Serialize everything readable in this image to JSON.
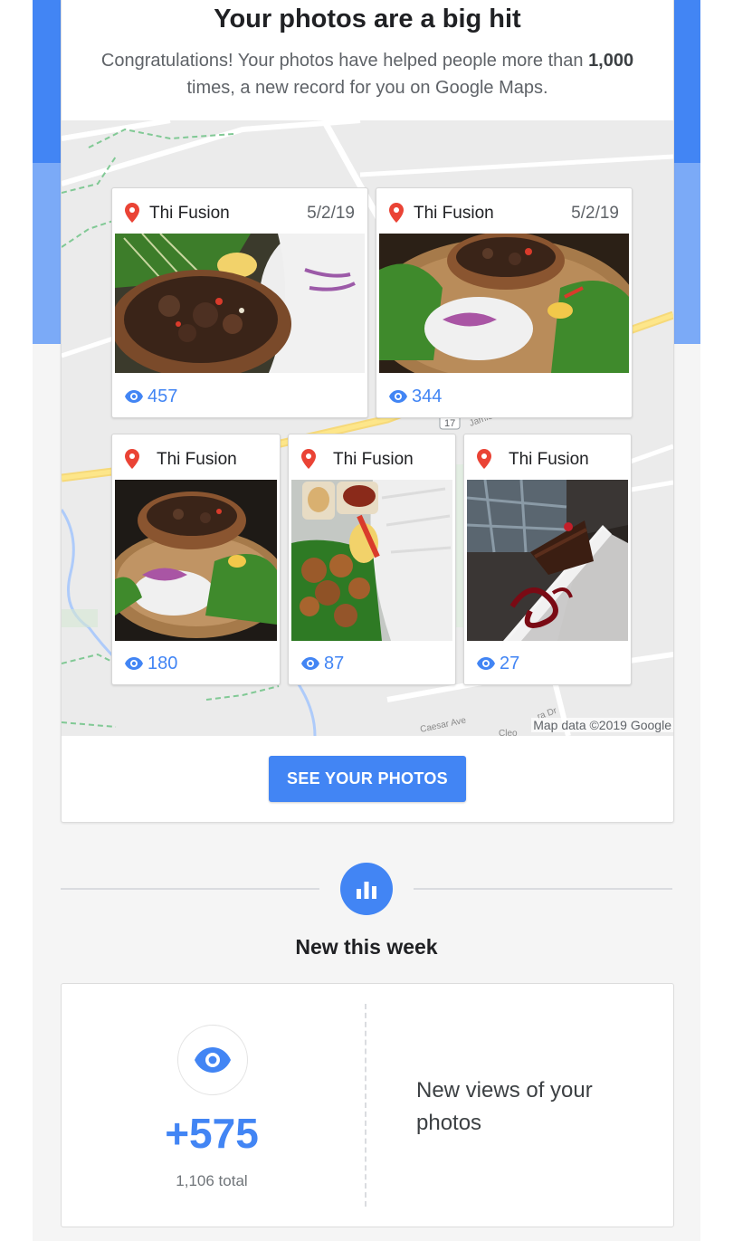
{
  "header": {
    "title": "Your photos are a big hit",
    "subtitle_before": "Congratulations! Your photos have helped people more than ",
    "subtitle_bold": "1,000",
    "subtitle_after": " times, a new record for you on Google Maps."
  },
  "map": {
    "credit": "Map data ©2019 Google",
    "street_labels": [
      "Caesar Ave",
      "Jamie",
      "Cleo",
      "ra Dr",
      "17"
    ]
  },
  "photos": [
    {
      "place": "Thi Fusion",
      "date": "5/2/19",
      "views": "457",
      "subject": "pork bowl with vermicelli"
    },
    {
      "place": "Thi Fusion",
      "date": "5/2/19",
      "views": "344",
      "subject": "bowl on basket"
    },
    {
      "place": "Thi Fusion",
      "views": "180",
      "subject": "bowl on basket"
    },
    {
      "place": "Thi Fusion",
      "views": "87",
      "subject": "grilled chicken with sauces"
    },
    {
      "place": "Thi Fusion",
      "views": "27",
      "subject": "chocolate cake dessert"
    }
  ],
  "cta": {
    "label": "SEE YOUR PHOTOS"
  },
  "section": {
    "title": "New this week"
  },
  "stat": {
    "delta": "+575",
    "total": "1,106 total",
    "description": "New views of your photos"
  },
  "colors": {
    "accent": "#4285f4",
    "pin": "#ea4335",
    "band_light": "#7baaf7"
  },
  "icons": {
    "pin": "map-pin-icon",
    "views": "eye-icon",
    "chart": "bar-chart-icon"
  }
}
